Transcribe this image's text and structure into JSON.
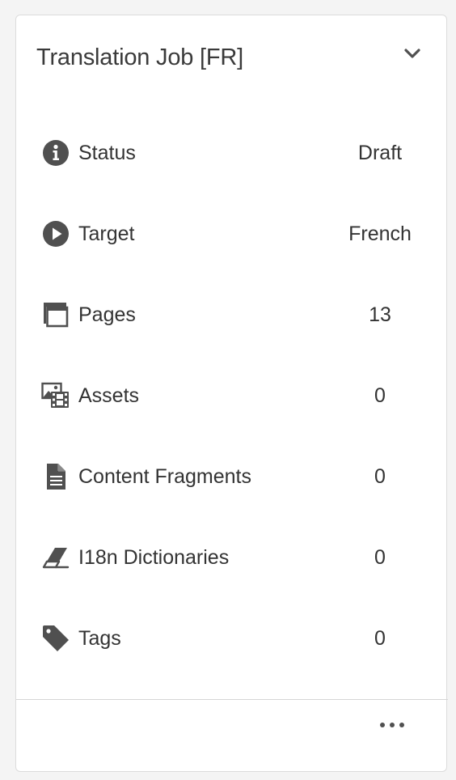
{
  "card": {
    "title": "Translation Job [FR]",
    "collapse_icon": "chevron-down-icon",
    "more_icon": "more-icon"
  },
  "rows": [
    {
      "label": "Status",
      "value": "Draft",
      "icon": "info-icon"
    },
    {
      "label": "Target",
      "value": "French",
      "icon": "play-circle-icon"
    },
    {
      "label": "Pages",
      "value": "13",
      "icon": "pages-icon"
    },
    {
      "label": "Assets",
      "value": "0",
      "icon": "assets-icon"
    },
    {
      "label": "Content Fragments",
      "value": "0",
      "icon": "document-icon"
    },
    {
      "label": "I18n Dictionaries",
      "value": "0",
      "icon": "eraser-icon"
    },
    {
      "label": "Tags",
      "value": "0",
      "icon": "tag-icon"
    }
  ],
  "colors": {
    "icon": "#505050",
    "text": "#333333",
    "background": "#f4f4f4",
    "card": "#ffffff"
  }
}
